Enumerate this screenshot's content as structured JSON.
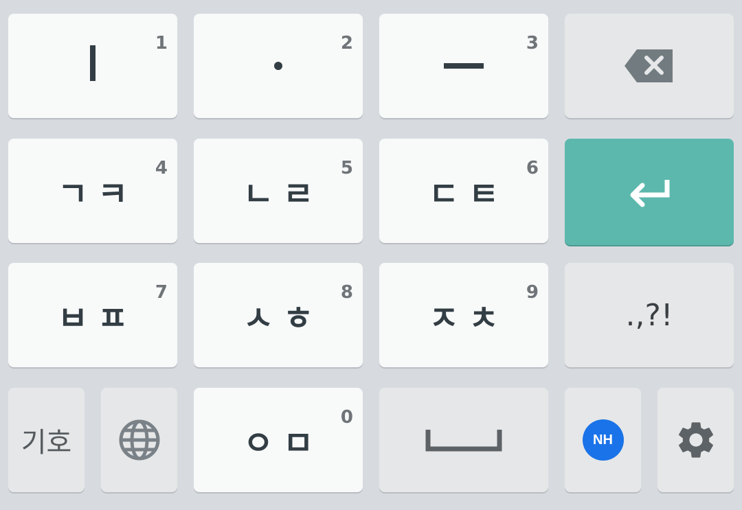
{
  "keyboard": {
    "row1": {
      "k1": {
        "label": "ㅣ",
        "hint": "1"
      },
      "k2": {
        "label": "·",
        "hint": "2"
      },
      "k3": {
        "label": "ㅡ",
        "hint": "3"
      },
      "backspace_icon": "backspace-icon"
    },
    "row2": {
      "k4": {
        "label": "ㄱㅋ",
        "hint": "4"
      },
      "k5": {
        "label": "ㄴㄹ",
        "hint": "5"
      },
      "k6": {
        "label": "ㄷㅌ",
        "hint": "6"
      },
      "enter_icon": "enter-arrow-icon"
    },
    "row3": {
      "k7": {
        "label": "ㅂㅍ",
        "hint": "7"
      },
      "k8": {
        "label": "ㅅㅎ",
        "hint": "8"
      },
      "k9": {
        "label": "ㅈㅊ",
        "hint": "9"
      },
      "punct": {
        "label": ".,?!"
      }
    },
    "row4": {
      "symbols": {
        "label": "기호"
      },
      "globe_icon": "globe-icon",
      "k0": {
        "label": "ㅇㅁ",
        "hint": "0"
      },
      "space_icon": "space-bar-icon",
      "nh": {
        "label": "NH"
      },
      "settings_icon": "gear-icon"
    }
  },
  "colors": {
    "background": "#d7dbe0",
    "key_light": "#f8f9f9",
    "key_dark": "#e6e7e8",
    "enter": "#5cb8ad",
    "nh_badge": "#1a73e8"
  }
}
